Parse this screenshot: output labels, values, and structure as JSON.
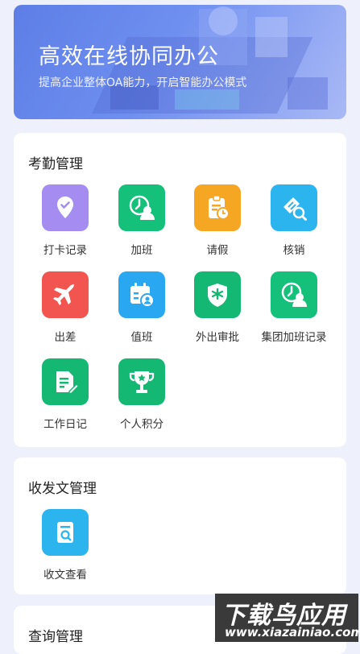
{
  "banner": {
    "title": "高效在线协同办公",
    "subtitle": "提高企业整体OA能力，开启智能办公模式"
  },
  "attendance": {
    "title": "考勤管理",
    "items": [
      {
        "label": "打卡记录",
        "icon": "location-check-icon",
        "color": "#a58cf0"
      },
      {
        "label": "加班",
        "icon": "clock-person-icon",
        "color": "#15c07a"
      },
      {
        "label": "请假",
        "icon": "clipboard-clock-icon",
        "color": "#f5a623"
      },
      {
        "label": "核销",
        "icon": "ticket-search-icon",
        "color": "#2cb4ef"
      },
      {
        "label": "出差",
        "icon": "airplane-icon",
        "color": "#f25450"
      },
      {
        "label": "值班",
        "icon": "calendar-person-icon",
        "color": "#2aa7f1"
      },
      {
        "label": "外出审批",
        "icon": "shield-star-icon",
        "color": "#15b873"
      },
      {
        "label": "集团加班记录",
        "icon": "clock-person-icon",
        "color": "#15c07a"
      },
      {
        "label": "工作日记",
        "icon": "document-pen-icon",
        "color": "#15b873"
      },
      {
        "label": "个人积分",
        "icon": "trophy-icon",
        "color": "#15b873"
      }
    ]
  },
  "documents": {
    "title": "收发文管理",
    "items": [
      {
        "label": "收文查看",
        "icon": "document-search-icon",
        "color": "#2cb4ef"
      }
    ]
  },
  "query": {
    "title": "查询管理"
  },
  "watermark": {
    "big": "下载鸟应用",
    "small": "www.xiazainiao.com"
  }
}
